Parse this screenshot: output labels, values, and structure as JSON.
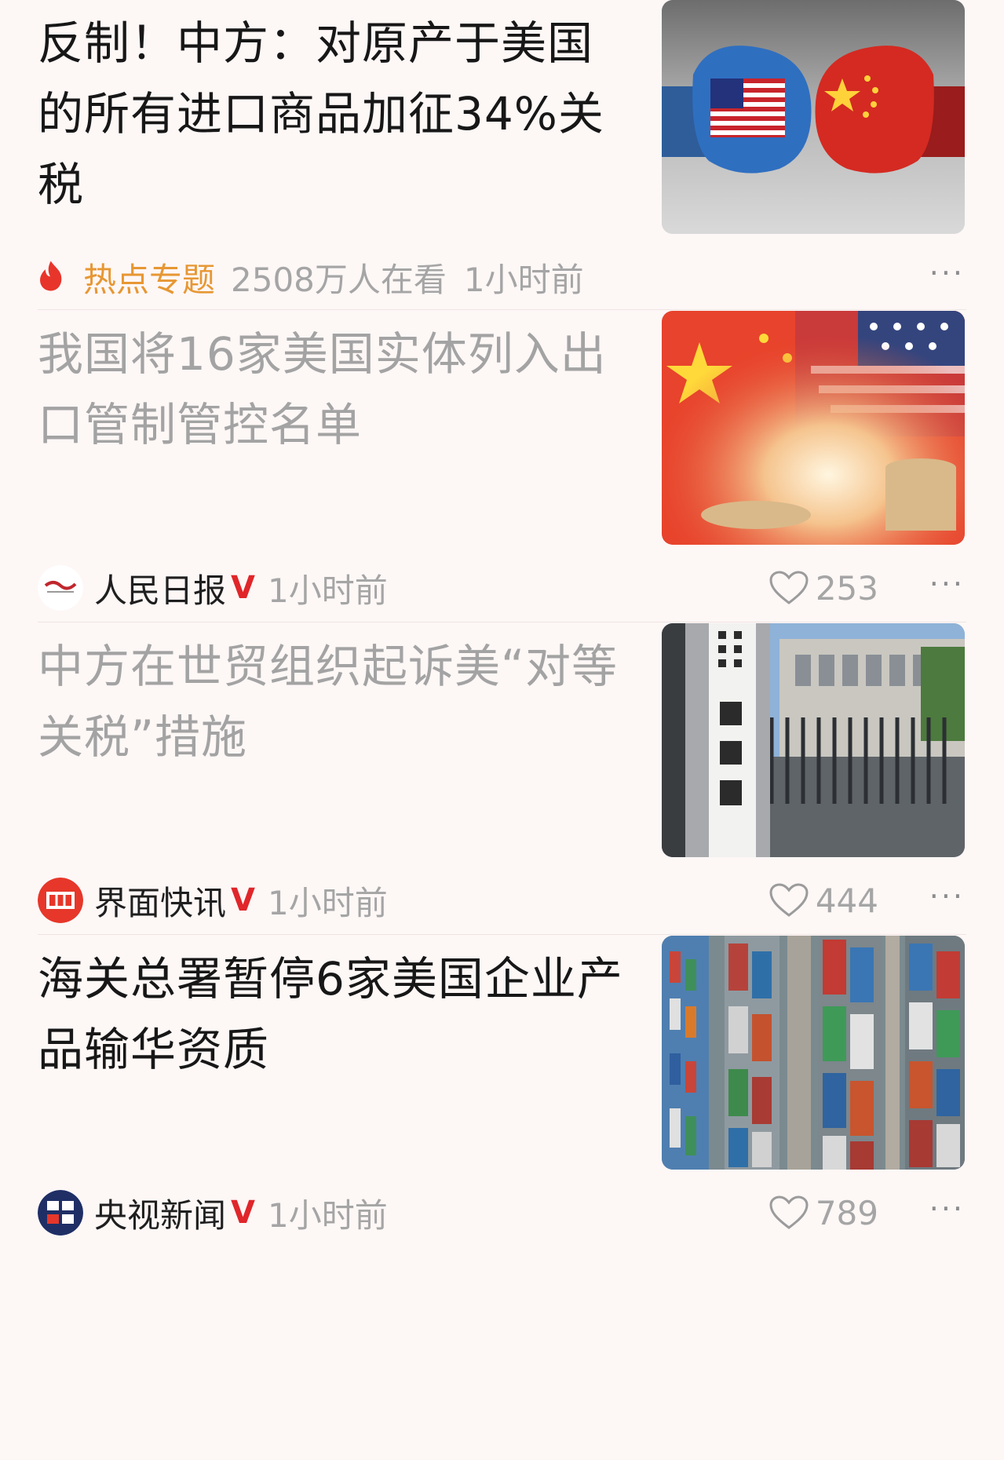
{
  "feed": [
    {
      "title": "反制！中方：对原产于美国的所有进口商品加征34%关税",
      "title_read": false,
      "thumbnail_icon": "boxing-gloves-us-china-image",
      "meta": {
        "tag": "热点专题",
        "views": "2508万人在看",
        "time": "1小时前"
      },
      "more": "···"
    },
    {
      "title": "我国将16家美国实体列入出口管制管控名单",
      "title_read": true,
      "thumbnail_icon": "china-us-flags-coins-image",
      "meta": {
        "source": "人民日报",
        "verified": "V",
        "time": "1小时前",
        "likes": "253"
      },
      "more": "···"
    },
    {
      "title": "中方在世贸组织起诉美“对等关税”措施",
      "title_read": true,
      "thumbnail_icon": "ministry-of-commerce-gate-image",
      "meta": {
        "source": "界面快讯",
        "verified": "V",
        "time": "1小时前",
        "likes": "444"
      },
      "more": "···"
    },
    {
      "title": "海关总署暂停6家美国企业产品输华资质",
      "title_read": false,
      "thumbnail_icon": "container-port-aerial-image",
      "meta": {
        "source": "央视新闻",
        "verified": "V",
        "time": "1小时前",
        "likes": "789"
      },
      "more": "···"
    }
  ],
  "colors": {
    "background": "#fdf7f6",
    "hot_tag": "#e79733",
    "verified": "#e0262a",
    "read_title": "#a3a3a3"
  }
}
